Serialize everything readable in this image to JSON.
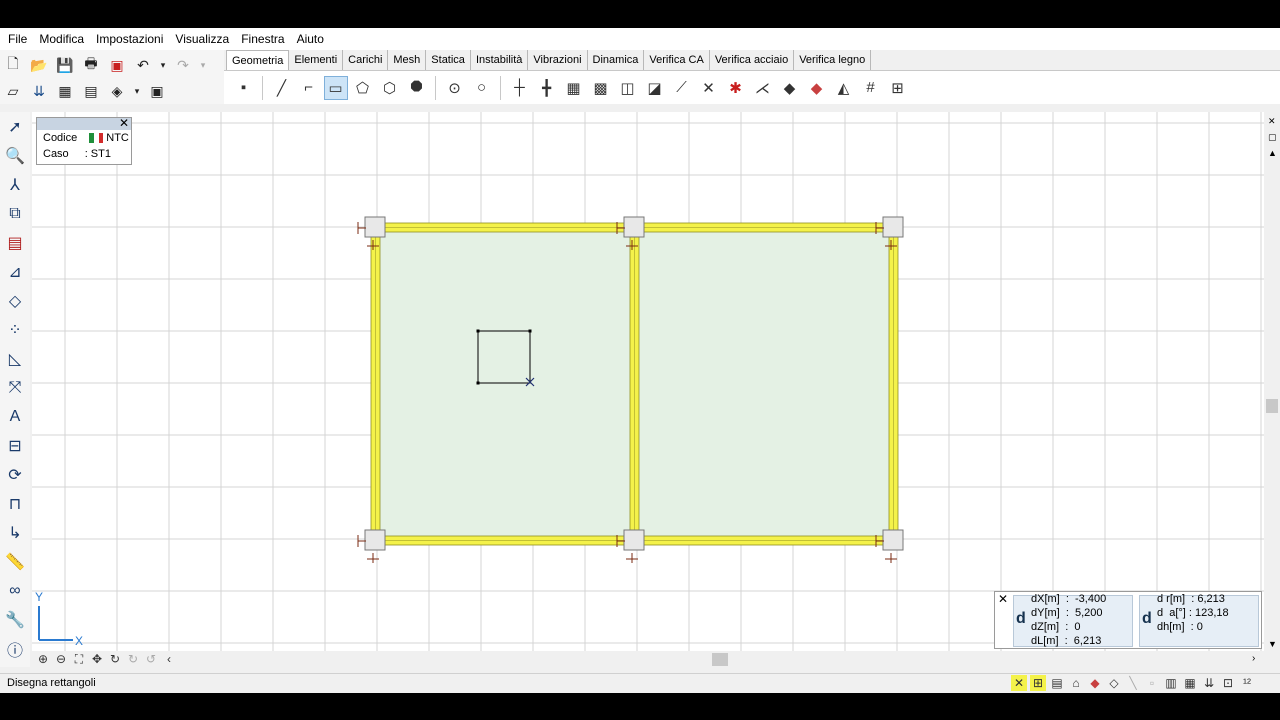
{
  "menu": {
    "items": [
      "File",
      "Modifica",
      "Impostazioni",
      "Visualizza",
      "Finestra",
      "Aiuto"
    ]
  },
  "tabs": [
    "Geometria",
    "Elementi",
    "Carichi",
    "Mesh",
    "Statica",
    "Instabilità",
    "Vibrazioni",
    "Dinamica",
    "Verifica CA",
    "Verifica acciaio",
    "Verifica legno"
  ],
  "active_tab": "Geometria",
  "info_panel": {
    "codice_label": "Codice",
    "codice_value": "NTC",
    "caso_label": "Caso",
    "caso_value": ": ST1"
  },
  "axes": {
    "y_label": "Y",
    "x_label": "X"
  },
  "coords": {
    "left_symbol": "d",
    "right_symbol": "d",
    "dx": "dX[m]  :  -3,400",
    "dy": "dY[m]  :  5,200",
    "dz": "dZ[m]  :  0",
    "dl": "dL[m]  :  6,213",
    "dr": "d r[m]  : 6,213",
    "da": "d  a[°] : 123,18",
    "dh": "dh[m]  : 0"
  },
  "status": {
    "text": "Disegna rettangoli"
  },
  "colors": {
    "beam_yellow": "#f4f24a",
    "slab_fill": "#e4f1e4",
    "grid": "#d4d4d4",
    "active_tab_bg": "#ffffff",
    "selected_tool": "#cde4f7"
  }
}
